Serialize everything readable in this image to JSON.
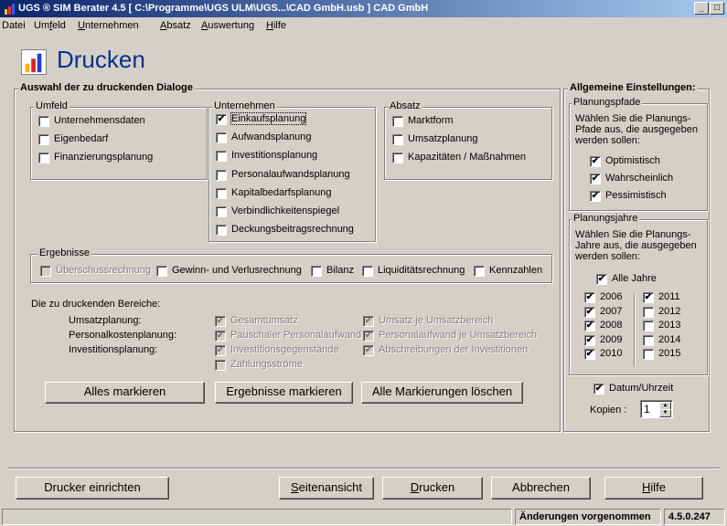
{
  "window": {
    "title": "UGS ® SIM Berater 4.5  [ C:\\Programme\\UGS ULM\\UGS...\\CAD GmbH.usb ] CAD GmbH",
    "icon": "bar-chart-icon",
    "controls": [
      "_",
      "□",
      "×"
    ]
  },
  "menu": {
    "datei": "Datei",
    "umfeld_pre": "Um",
    "umfeld_u": "f",
    "umfeld_post": "eld",
    "unternehmen_u": "U",
    "unternehmen_post": "nternehmen",
    "absatz_u": "A",
    "absatz_post": "bsatz",
    "auswertung_u": "A",
    "auswertung_post": "uswertung",
    "hilfe_u": "H",
    "hilfe_post": "ilfe"
  },
  "page_title": "Drucken",
  "selection": {
    "title": "Auswahl der zu druckenden Dialoge",
    "umfeld": {
      "label": "Umfeld",
      "items": [
        {
          "label": "Unternehmensdaten",
          "checked": false
        },
        {
          "label": "Eigenbedarf",
          "checked": false
        },
        {
          "label": "Finanzierungsplanung",
          "checked": false
        }
      ]
    },
    "unternehmen": {
      "label": "Unternehmen",
      "items": [
        {
          "label": "Einkaufsplanung",
          "checked": true
        },
        {
          "label": "Aufwandsplanung",
          "checked": false
        },
        {
          "label": "Investitionsplanung",
          "checked": false
        },
        {
          "label": "Personalaufwandsplanung",
          "checked": false
        },
        {
          "label": "Kapitalbedarfsplanung",
          "checked": false
        },
        {
          "label": "Verbindlichkeitenspiegel",
          "checked": false
        },
        {
          "label": "Deckungsbeitragsrechnung",
          "checked": false
        }
      ]
    },
    "absatz": {
      "label": "Absatz",
      "items": [
        {
          "label": "Marktform",
          "checked": false
        },
        {
          "label": "Umsatzplanung",
          "checked": false
        },
        {
          "label": "Kapazitäten / Maßnahmen",
          "checked": false
        }
      ]
    },
    "ergebnisse": {
      "label": "Ergebnisse",
      "items": [
        {
          "label": "Überschussrechnung",
          "checked": false,
          "disabled": true
        },
        {
          "label": "Gewinn- und Verlusrechnung",
          "checked": false
        },
        {
          "label": "Bilanz",
          "checked": false
        },
        {
          "label": "Liquiditätsrechnung",
          "checked": false
        },
        {
          "label": "Kennzahlen",
          "checked": false
        }
      ]
    },
    "bereiche": {
      "heading": "Die zu druckenden Bereiche:",
      "rows": [
        {
          "label": "Umsatzplanung:",
          "a": "Gesamtumsatz",
          "b": "Umsatz je Umsatzbereich"
        },
        {
          "label": "Personalkostenplanung:",
          "a": "Pauschaler Personalaufwand",
          "b": "Personalaufwand je Umsatzbereich"
        },
        {
          "label": "Investitionsplanung:",
          "a": "Investitionsgegenstände",
          "b": "Abschreibungen der Investitionen"
        }
      ],
      "extra": "Zahlungsströme"
    },
    "buttons": {
      "mark_all": "Alles markieren",
      "mark_results": "Ergebnisse markieren",
      "clear_all": "Alle Markierungen löschen"
    }
  },
  "settings": {
    "title": "Allgemeine Einstellungen:",
    "pfade": {
      "label": "Planungspfade",
      "desc1": "Wählen Sie die Planungs-",
      "desc2": "Pfade aus, die ausgegeben",
      "desc3": "werden sollen:",
      "items": [
        {
          "label": "Optimistisch",
          "checked": true
        },
        {
          "label": "Wahrscheinlich",
          "checked": true
        },
        {
          "label": "Pessimistisch",
          "checked": true
        }
      ]
    },
    "jahre": {
      "label": "Planungsjahre",
      "desc1": "Wählen Sie die Planungs-",
      "desc2": "Jahre aus, die ausgegeben",
      "desc3": "werden sollen:",
      "all": {
        "label": "Alle Jahre",
        "checked": true
      },
      "left": [
        {
          "label": "2006",
          "checked": true
        },
        {
          "label": "2007",
          "checked": true
        },
        {
          "label": "2008",
          "checked": true
        },
        {
          "label": "2009",
          "checked": true
        },
        {
          "label": "2010",
          "checked": true
        }
      ],
      "right": [
        {
          "label": "2011",
          "checked": true
        },
        {
          "label": "2012",
          "checked": false
        },
        {
          "label": "2013",
          "checked": false
        },
        {
          "label": "2014",
          "checked": false
        },
        {
          "label": "2015",
          "checked": false
        }
      ]
    },
    "datum": {
      "label": "Datum/Uhrzeit",
      "checked": true
    },
    "kopien": {
      "label": "Kopien :",
      "value": "1"
    }
  },
  "bottom": {
    "drucker": "Drucker einrichten",
    "seiten_u": "S",
    "seiten_post": "eitenansicht",
    "drucken_u": "D",
    "drucken_post": "rucken",
    "abbrechen": "Abbrechen",
    "hilfe_u": "H",
    "hilfe_post": "ilfe"
  },
  "status": {
    "message": "Änderungen vorgenommen",
    "version": "4.5.0.247"
  },
  "checkmark": "✔"
}
